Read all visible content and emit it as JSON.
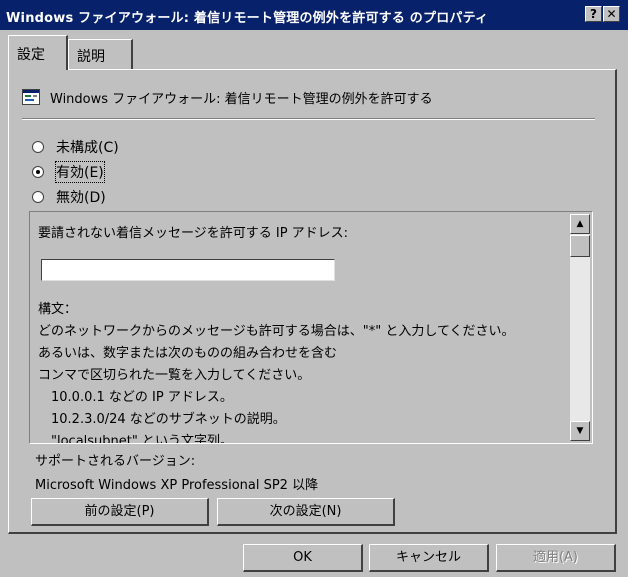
{
  "window": {
    "title": "Windows ファイアウォール: 着信リモート管理の例外を許可する のプロパティ",
    "help_button": "?",
    "close_button": "✕"
  },
  "tabs": [
    {
      "label": "設定",
      "active": true
    },
    {
      "label": "説明",
      "active": false
    }
  ],
  "policy": {
    "title": "Windows ファイアウォール: 着信リモート管理の例外を許可する",
    "icon": "policy-setting-icon"
  },
  "radios": [
    {
      "label": "未構成(C)",
      "selected": false
    },
    {
      "label": "有効(E)",
      "selected": true
    },
    {
      "label": "無効(D)",
      "selected": false
    }
  ],
  "options": {
    "ip_label": "要請されない着信メッセージを許可する IP アドレス:",
    "ip_value": "",
    "lines": [
      "構文：",
      "どのネットワークからのメッセージも許可する場合は、\"*\" と入力してください。",
      "あるいは、数字または次のものの組み合わせを含む",
      "コンマで区切られた一覧を入力してください。",
      "　10.0.0.1 などの IP アドレス。",
      "　10.2.3.0/24 などのサブネットの説明。",
      "　\"localsubnet\" という文字列。"
    ]
  },
  "supported": {
    "label": "サポートされるバージョン:",
    "value": "Microsoft Windows XP Professional SP2 以降"
  },
  "buttons": {
    "prev": "前の設定(P)",
    "next": "次の設定(N)",
    "ok": "OK",
    "cancel": "キャンセル",
    "apply": "適用(A)"
  }
}
